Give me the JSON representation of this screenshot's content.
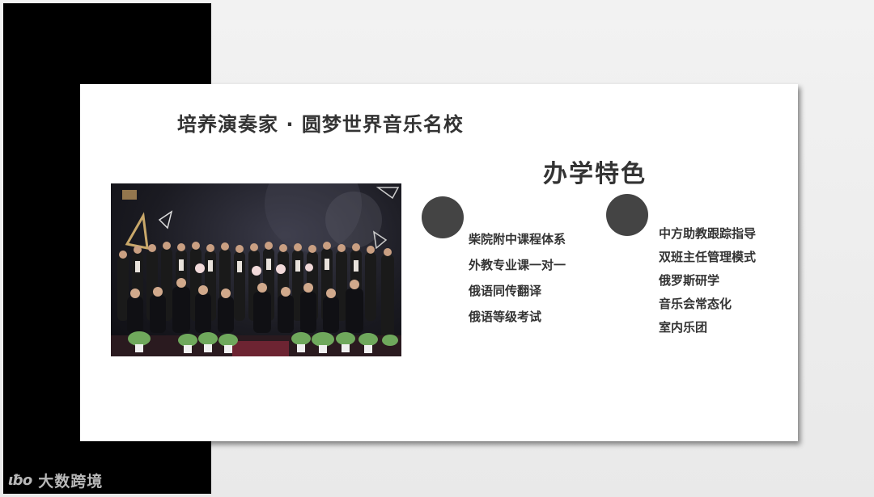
{
  "slide": {
    "title": "培养演奏家 · 圆梦世界音乐名校",
    "section_title": "办学特色",
    "features_left": [
      "柴院附中课程体系",
      "外教专业课一对一",
      "俄语同传翻译",
      "俄语等级考试"
    ],
    "features_right": [
      "中方助教跟踪指导",
      "双班主任管理模式",
      "俄罗斯研学",
      "音乐会常态化",
      "室内乐团"
    ],
    "photo_icon": "group-photo-concert"
  },
  "watermark": {
    "logo": "ιƀo",
    "text": "大数跨境"
  }
}
